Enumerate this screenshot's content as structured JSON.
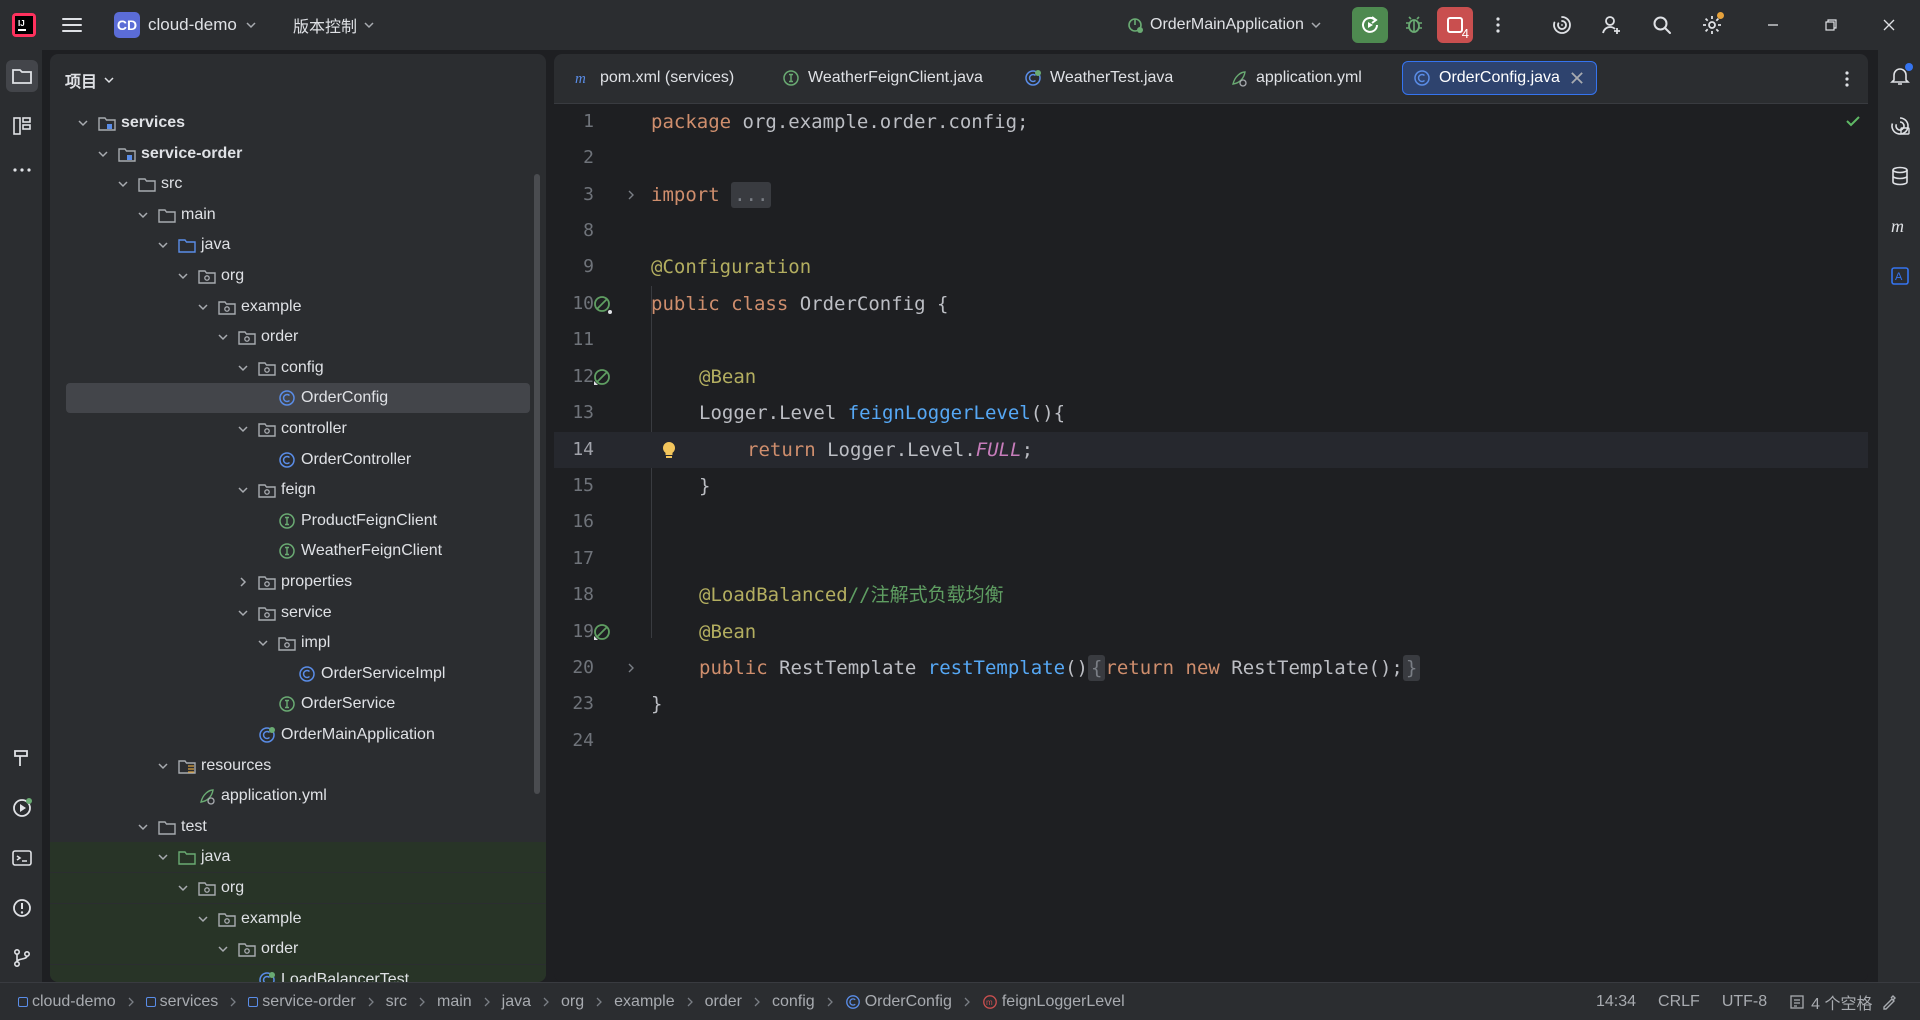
{
  "titlebar": {
    "project_badge": "CD",
    "project_name": "cloud-demo",
    "vcs_label": "版本控制",
    "run_config": "OrderMainApplication",
    "stop_count": "4"
  },
  "project_panel": {
    "header": "项目",
    "tree": [
      {
        "label": "services",
        "indent": 0,
        "expanded": true,
        "icon": "module-folder",
        "bold": true
      },
      {
        "label": "service-order",
        "indent": 1,
        "expanded": true,
        "icon": "module-folder",
        "bold": true
      },
      {
        "label": "src",
        "indent": 2,
        "expanded": true,
        "icon": "folder"
      },
      {
        "label": "main",
        "indent": 3,
        "expanded": true,
        "icon": "folder"
      },
      {
        "label": "java",
        "indent": 4,
        "expanded": true,
        "icon": "source-folder"
      },
      {
        "label": "org",
        "indent": 5,
        "expanded": true,
        "icon": "package"
      },
      {
        "label": "example",
        "indent": 6,
        "expanded": true,
        "icon": "package"
      },
      {
        "label": "order",
        "indent": 7,
        "expanded": true,
        "icon": "package"
      },
      {
        "label": "config",
        "indent": 8,
        "expanded": true,
        "icon": "package"
      },
      {
        "label": "OrderConfig",
        "indent": 9,
        "icon": "class",
        "selected": true
      },
      {
        "label": "controller",
        "indent": 8,
        "expanded": true,
        "icon": "package"
      },
      {
        "label": "OrderController",
        "indent": 9,
        "icon": "class"
      },
      {
        "label": "feign",
        "indent": 8,
        "expanded": true,
        "icon": "package"
      },
      {
        "label": "ProductFeignClient",
        "indent": 9,
        "icon": "interface"
      },
      {
        "label": "WeatherFeignClient",
        "indent": 9,
        "icon": "interface"
      },
      {
        "label": "properties",
        "indent": 8,
        "expanded": false,
        "icon": "package"
      },
      {
        "label": "service",
        "indent": 8,
        "expanded": true,
        "icon": "package"
      },
      {
        "label": "impl",
        "indent": 9,
        "expanded": true,
        "icon": "package"
      },
      {
        "label": "OrderServiceImpl",
        "indent": 10,
        "icon": "class"
      },
      {
        "label": "OrderService",
        "indent": 9,
        "icon": "interface"
      },
      {
        "label": "OrderMainApplication",
        "indent": 8,
        "icon": "spring-class"
      },
      {
        "label": "resources",
        "indent": 4,
        "expanded": true,
        "icon": "resources-folder"
      },
      {
        "label": "application.yml",
        "indent": 5,
        "icon": "yaml"
      },
      {
        "label": "test",
        "indent": 3,
        "expanded": true,
        "icon": "folder"
      },
      {
        "label": "java",
        "indent": 4,
        "expanded": true,
        "icon": "test-folder",
        "test": true
      },
      {
        "label": "org",
        "indent": 5,
        "expanded": true,
        "icon": "package",
        "test": true
      },
      {
        "label": "example",
        "indent": 6,
        "expanded": true,
        "icon": "package",
        "test": true
      },
      {
        "label": "order",
        "indent": 7,
        "expanded": true,
        "icon": "package",
        "test": true
      },
      {
        "label": "LoadBalancerTest",
        "indent": 8,
        "icon": "spring-class",
        "test": true
      }
    ]
  },
  "editor": {
    "tabs": [
      {
        "label": "pom.xml (services)",
        "icon": "maven"
      },
      {
        "label": "WeatherFeignClient.java",
        "icon": "interface"
      },
      {
        "label": "WeatherTest.java",
        "icon": "spring-class"
      },
      {
        "label": "application.yml",
        "icon": "yaml"
      },
      {
        "label": "OrderConfig.java",
        "icon": "class",
        "active": true
      }
    ],
    "lines": [
      {
        "n": "1"
      },
      {
        "n": "2"
      },
      {
        "n": "3"
      },
      {
        "n": "8"
      },
      {
        "n": "9"
      },
      {
        "n": "10"
      },
      {
        "n": "11"
      },
      {
        "n": "12"
      },
      {
        "n": "13"
      },
      {
        "n": "14"
      },
      {
        "n": "15"
      },
      {
        "n": "16"
      },
      {
        "n": "17"
      },
      {
        "n": "18"
      },
      {
        "n": "19"
      },
      {
        "n": "20"
      },
      {
        "n": "23"
      },
      {
        "n": "24"
      }
    ],
    "code": {
      "l1_kw": "package",
      "l1_rest": " org.example.order.config;",
      "l3_kw": "import",
      "l3_fold": "...",
      "l9_ann": "@Configuration",
      "l10_kw": "public class",
      "l10_rest": " OrderConfig {",
      "l12_ann": "@Bean",
      "l13_type": "Logger.Level ",
      "l13_fn": "feignLoggerLevel",
      "l13_rest": "(){",
      "l14_kw": "return",
      "l14_mid": " Logger.Level.",
      "l14_it": "FULL",
      "l14_end": ";",
      "l15": "}",
      "l18_ann": "@LoadBalanced",
      "l18_cm": "//注解式负载均衡",
      "l19_ann": "@Bean",
      "l20_kw": "public",
      "l20_type": " RestTemplate ",
      "l20_fn": "restTemplate",
      "l20_paren": "()",
      "l20_fold1": "{",
      "l20_kw2": "return",
      "l20_kw3": "new",
      "l20_rest": " RestTemplate();",
      "l20_fold2": "}",
      "l23": "}"
    }
  },
  "statusbar": {
    "crumbs": [
      "cloud-demo",
      "services",
      "service-order",
      "src",
      "main",
      "java",
      "org",
      "example",
      "order",
      "config",
      "OrderConfig",
      "feignLoggerLevel"
    ],
    "position": "14:34",
    "line_sep": "CRLF",
    "encoding": "UTF-8",
    "indent": "4 个空格"
  },
  "colors": {
    "accent": "#3574f0",
    "run_green": "#4e8a50",
    "stop_red": "#c94f4f",
    "keyword": "#cf8e6d",
    "annotation": "#b3ae60",
    "function": "#56a8f5"
  }
}
